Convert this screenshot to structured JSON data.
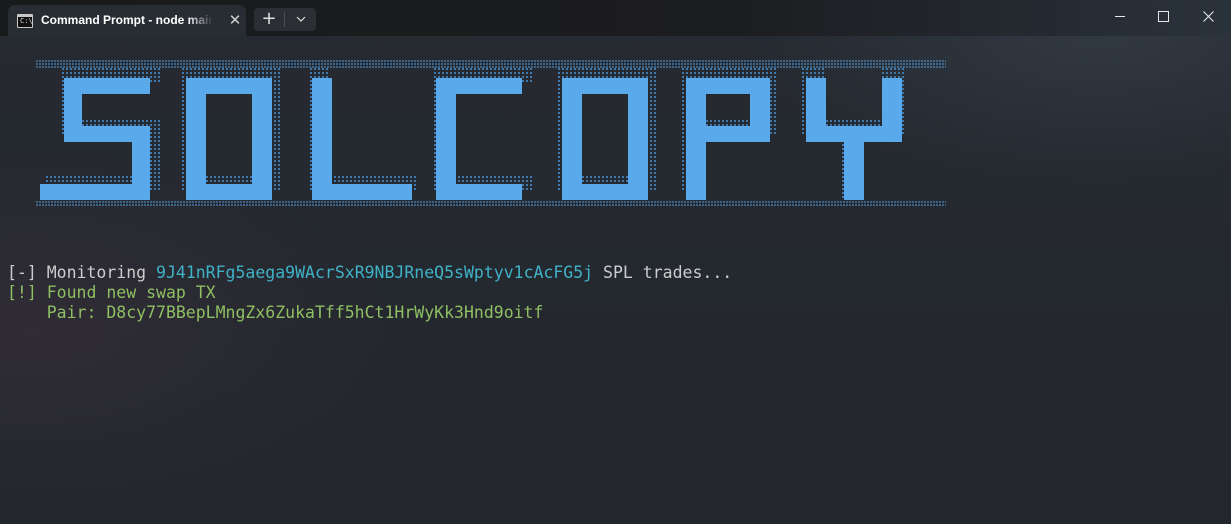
{
  "window": {
    "tab_title": "Command Prompt - node  main",
    "tab_icon": "cmd-icon",
    "close_tab_glyph": "✕",
    "new_tab_glyph": "+",
    "dropdown_glyph": "⌄",
    "minimize_icon": "minimize-icon",
    "maximize_icon": "maximize-icon",
    "close_glyph": "✕"
  },
  "banner": {
    "text": "SOLCOPY",
    "color": "#5aa9ea"
  },
  "terminal": {
    "line1": {
      "prefix": "[-] Monitoring ",
      "address": "9J41nRFg5aega9WAcrSxR9NBJRneQ5sWptyv1cAcFG5j",
      "suffix": " SPL trades..."
    },
    "line2": "[!] Found new swap TX",
    "line3": "    Pair: D8cy77BBepLMngZx6ZukaTff5hCt1HrWyKk3Hnd9oitf"
  },
  "colors": {
    "text": "#cccccc",
    "cyan": "#3fb2c7",
    "green": "#8fbf63",
    "background": "#23272e"
  }
}
